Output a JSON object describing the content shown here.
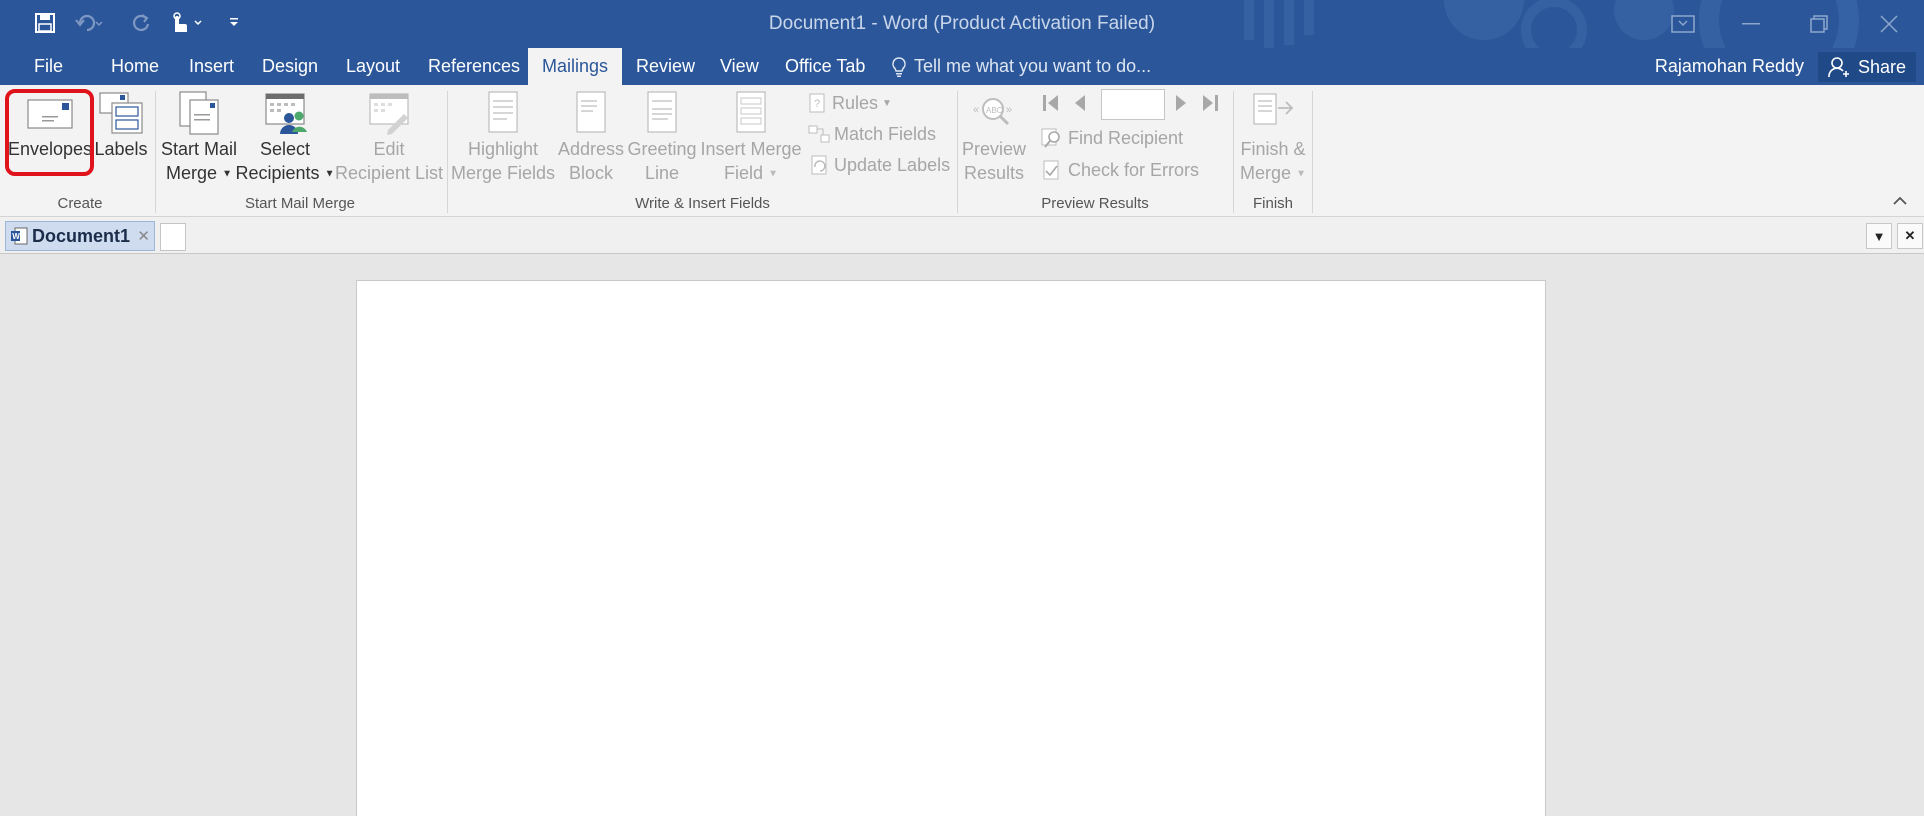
{
  "window": {
    "title": "Document1 - Word (Product Activation Failed)"
  },
  "tabs": [
    "File",
    "Home",
    "Insert",
    "Design",
    "Layout",
    "References",
    "Mailings",
    "Review",
    "View",
    "Office Tab"
  ],
  "active_tab": "Mailings",
  "tell_me": "Tell me what you want to do...",
  "user": {
    "name": "Rajamohan Reddy",
    "share_label": "Share"
  },
  "ribbon": {
    "create": {
      "label": "Create",
      "envelopes": "Envelopes",
      "labels": "Labels"
    },
    "start_mail_merge": {
      "label": "Start Mail Merge",
      "start_mail_merge_line1": "Start Mail",
      "start_mail_merge_line2": "Merge",
      "select_recipients_line1": "Select",
      "select_recipients_line2": "Recipients",
      "edit_recipient_list_line1": "Edit",
      "edit_recipient_list_line2": "Recipient List"
    },
    "write_insert": {
      "label": "Write & Insert Fields",
      "highlight_line1": "Highlight",
      "highlight_line2": "Merge Fields",
      "address_line1": "Address",
      "address_line2": "Block",
      "greeting_line1": "Greeting",
      "greeting_line2": "Line",
      "insert_merge_line1": "Insert Merge",
      "insert_merge_line2": "Field",
      "rules": "Rules",
      "match_fields": "Match Fields",
      "update_labels": "Update Labels"
    },
    "preview": {
      "label": "Preview Results",
      "preview_results_line1": "Preview",
      "preview_results_line2": "Results",
      "find_recipient": "Find Recipient",
      "check_errors": "Check for Errors",
      "record_value": ""
    },
    "finish": {
      "label": "Finish",
      "finish_merge_line1": "Finish &",
      "finish_merge_line2": "Merge"
    }
  },
  "document_tabs": {
    "active": "Document1"
  },
  "colors": {
    "title_bar": "#2b579a",
    "highlight": "#e0121c"
  }
}
